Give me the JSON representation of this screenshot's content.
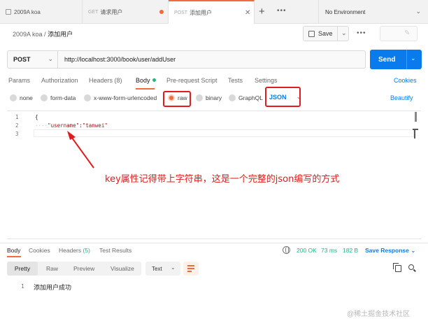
{
  "tabs": [
    {
      "method": "",
      "label": "2009A koa",
      "dirty": false,
      "active": false
    },
    {
      "method": "GET",
      "label": "请求用户",
      "dirty": true,
      "active": false
    },
    {
      "method": "POST",
      "label": "添加用户",
      "dirty": false,
      "active": true
    }
  ],
  "environment": "No Environment",
  "breadcrumb": {
    "parent": "2009A koa",
    "separator": " / ",
    "title": "添加用户"
  },
  "save_label": "Save",
  "request": {
    "method": "POST",
    "url": "http://localhost:3000/book/user/addUser",
    "send_label": "Send"
  },
  "request_tabs": [
    {
      "label": "Params",
      "active": false
    },
    {
      "label": "Authorization",
      "active": false
    },
    {
      "label": "Headers",
      "count": "(8)",
      "active": false
    },
    {
      "label": "Body",
      "active": true
    },
    {
      "label": "Pre-request Script",
      "active": false
    },
    {
      "label": "Tests",
      "active": false
    },
    {
      "label": "Settings",
      "active": false
    }
  ],
  "cookies_link": "Cookies",
  "body_types": [
    "none",
    "form-data",
    "x-www-form-urlencoded",
    "raw",
    "binary",
    "GraphQL"
  ],
  "selected_body_type": "raw",
  "body_format": "JSON",
  "beautify_label": "Beautify",
  "editor": {
    "line_numbers": [
      "1",
      "2",
      "3"
    ],
    "line1": "{",
    "indent": "····",
    "key": "\"username\"",
    "colon": ":",
    "value": "\"tanwei\""
  },
  "annotation": "key属性记得带上字符串，这是一个完整的json编写的方式",
  "response_tabs": [
    {
      "label": "Body",
      "active": true
    },
    {
      "label": "Cookies",
      "active": false
    },
    {
      "label": "Headers",
      "count": "(5)",
      "active": false
    },
    {
      "label": "Test Results",
      "active": false
    }
  ],
  "response_status": {
    "status": "200 OK",
    "time": "73 ms",
    "size": "182 B"
  },
  "save_response_label": "Save Response",
  "response_formats": [
    "Pretty",
    "Raw",
    "Preview",
    "Visualize"
  ],
  "response_format_active": "Pretty",
  "response_type": "Text",
  "response_body": {
    "line": "1",
    "text": "添加用户成功"
  },
  "watermark": "@稀土掘金技术社区",
  "colors": {
    "accent": "#f26b3a",
    "primary": "#097bed",
    "success": "#26b47f",
    "annotation": "#e21c1c"
  }
}
